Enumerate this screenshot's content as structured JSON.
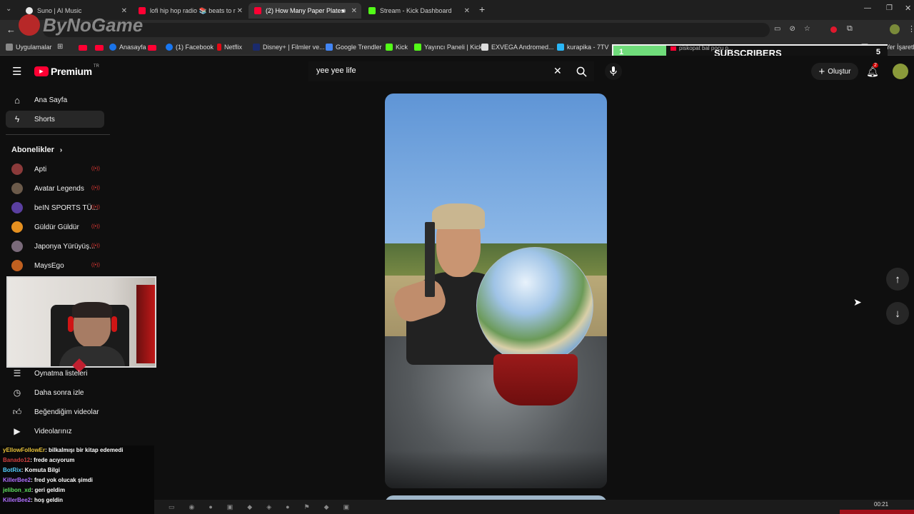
{
  "browser": {
    "tabs": [
      {
        "title": "Suno | AI Music",
        "color": "#f0f0f0"
      },
      {
        "title": "lofi hip hop radio 📚 beats to r",
        "color": "#ff0033"
      },
      {
        "title": "(2) How Many Paper Plates",
        "color": "#ff0033"
      },
      {
        "title": "Stream - Kick Dashboard",
        "color": "#53fc18"
      }
    ],
    "new_tab": "+",
    "bookmarks": [
      {
        "label": "Uygulamalar"
      },
      {
        "label": "Anasayfa"
      },
      {
        "label": "(1) Facebook"
      },
      {
        "label": "Netflix"
      },
      {
        "label": "Disney+ | Filmler ve..."
      },
      {
        "label": "Google Trendler"
      },
      {
        "label": "Kick"
      },
      {
        "label": "Yayıncı Paneli | Kick"
      },
      {
        "label": "EXVEGA Andromed..."
      },
      {
        "label": "kurapika - 7TV"
      },
      {
        "label": "piskopat bal pocu p..."
      },
      {
        "label": "Tüm Yer İşaretleri"
      }
    ]
  },
  "overlay": {
    "watermark": "ByNoGame",
    "subscribers_label": "SUBSCRIBERS",
    "subscribers_current": "1",
    "subscribers_goal": "5"
  },
  "youtube": {
    "logo": "Premium",
    "region": "TR",
    "search_value": "yee yee life",
    "create_label": "Oluştur",
    "notif_count": "2"
  },
  "sidebar": {
    "items": [
      {
        "label": "Ana Sayfa"
      },
      {
        "label": "Shorts"
      }
    ],
    "subs_heading": "Abonelikler",
    "subs": [
      {
        "label": "Apti",
        "color": "#8b3a3a"
      },
      {
        "label": "Avatar Legends",
        "color": "#6b5a4a"
      },
      {
        "label": "beIN SPORTS TÜ...",
        "color": "#5a3fa0"
      },
      {
        "label": "Güldür Güldür",
        "color": "#e59020"
      },
      {
        "label": "Japonya Yürüyüş...",
        "color": "#7a6a7a"
      },
      {
        "label": "MaysEgo",
        "color": "#c06020"
      }
    ],
    "lower": [
      {
        "label": "Oynatma listeleri"
      },
      {
        "label": "Daha sonra izle"
      },
      {
        "label": "Beğendiğim videolar"
      },
      {
        "label": "Videolarınız"
      }
    ]
  },
  "chat": [
    {
      "user": "yEllowFollowEr",
      "msg": ": bilkalmışı bir kitap edemedi",
      "color": "#e8c33a"
    },
    {
      "user": "Banado12",
      "msg": ": frede acıyorum",
      "color": "#d04040"
    },
    {
      "user": "BotRix",
      "msg": ": Komuta Bilgi",
      "color": "#55d0ff"
    },
    {
      "user": "KillerBee2",
      "msg": ": fred yok olucak şimdi",
      "color": "#b070ff"
    },
    {
      "user": "jelibon_xd",
      "msg": ": geri geldim",
      "color": "#60e060"
    },
    {
      "user": "KillerBee2",
      "msg": ": hoş geldin",
      "color": "#b070ff"
    }
  ],
  "taskbar": {
    "time": "00:21"
  }
}
